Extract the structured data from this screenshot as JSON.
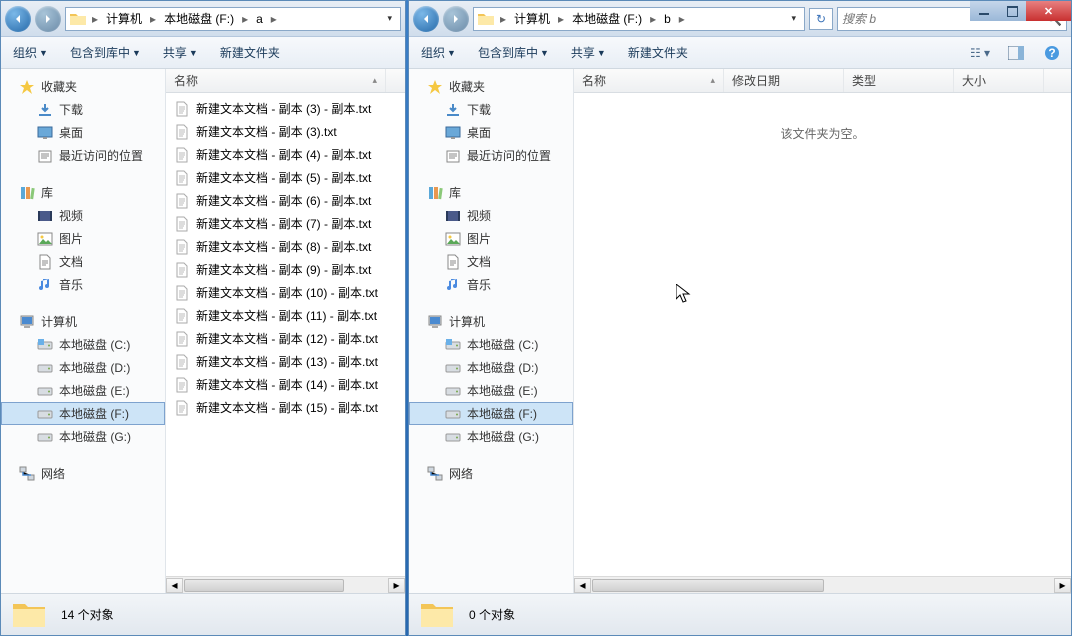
{
  "left": {
    "breadcrumb": [
      "计算机",
      "本地磁盘 (F:)",
      "a"
    ],
    "toolbar": {
      "organize": "组织",
      "include": "包含到库中",
      "share": "共享",
      "newfolder": "新建文件夹"
    },
    "columns": {
      "name": "名称"
    },
    "sidebar": {
      "favorites": {
        "label": "收藏夹",
        "items": [
          "下载",
          "桌面",
          "最近访问的位置"
        ]
      },
      "libraries": {
        "label": "库",
        "items": [
          "视频",
          "图片",
          "文档",
          "音乐"
        ]
      },
      "computer": {
        "label": "计算机",
        "items": [
          "本地磁盘 (C:)",
          "本地磁盘 (D:)",
          "本地磁盘 (E:)",
          "本地磁盘 (F:)",
          "本地磁盘 (G:)"
        ]
      },
      "network": {
        "label": "网络"
      }
    },
    "files": [
      "新建文本文档 - 副本 (3) - 副本.txt",
      "新建文本文档 - 副本 (3).txt",
      "新建文本文档 - 副本 (4) - 副本.txt",
      "新建文本文档 - 副本 (5) - 副本.txt",
      "新建文本文档 - 副本 (6) - 副本.txt",
      "新建文本文档 - 副本 (7) - 副本.txt",
      "新建文本文档 - 副本 (8) - 副本.txt",
      "新建文本文档 - 副本 (9) - 副本.txt",
      "新建文本文档 - 副本 (10) - 副本.txt",
      "新建文本文档 - 副本 (11) - 副本.txt",
      "新建文本文档 - 副本 (12) - 副本.txt",
      "新建文本文档 - 副本 (13) - 副本.txt",
      "新建文本文档 - 副本 (14) - 副本.txt",
      "新建文本文档 - 副本 (15) - 副本.txt"
    ],
    "status": "14 个对象"
  },
  "right": {
    "breadcrumb": [
      "计算机",
      "本地磁盘 (F:)",
      "b"
    ],
    "search_placeholder": "搜索 b",
    "toolbar": {
      "organize": "组织",
      "include": "包含到库中",
      "share": "共享",
      "newfolder": "新建文件夹"
    },
    "columns": {
      "name": "名称",
      "modified": "修改日期",
      "type": "类型",
      "size": "大小"
    },
    "empty": "该文件夹为空。",
    "sidebar": {
      "favorites": {
        "label": "收藏夹",
        "items": [
          "下载",
          "桌面",
          "最近访问的位置"
        ]
      },
      "libraries": {
        "label": "库",
        "items": [
          "视频",
          "图片",
          "文档",
          "音乐"
        ]
      },
      "computer": {
        "label": "计算机",
        "items": [
          "本地磁盘 (C:)",
          "本地磁盘 (D:)",
          "本地磁盘 (E:)",
          "本地磁盘 (F:)",
          "本地磁盘 (G:)"
        ]
      },
      "network": {
        "label": "网络"
      }
    },
    "status": "0 个对象"
  }
}
